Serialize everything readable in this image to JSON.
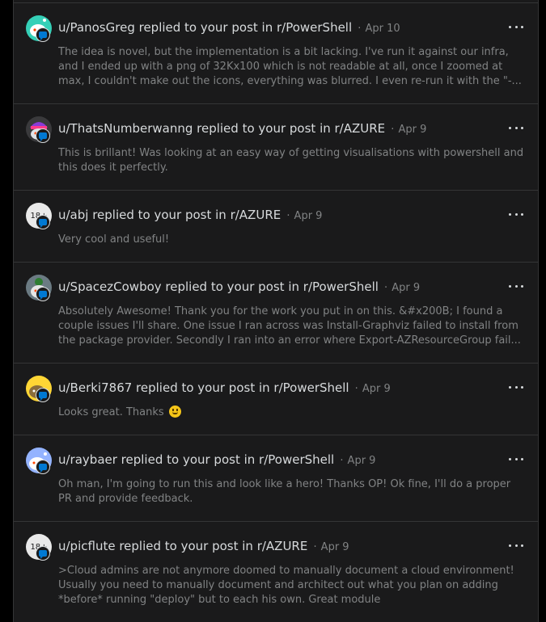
{
  "notifications": [
    {
      "title": "u/PanosGreg replied to your post in r/PowerShell",
      "separator": "·",
      "date": "Apr 10",
      "body": "The idea is novel, but the implementation is a bit lacking. I've run it against our infra, and I ended up with a png of 32Kx100 which is not readable at all, once I zoomed at max, I couldn't make out the icons, everything was blurred. I even re-run it with the \"-...",
      "avatar": "snoo-avatar-teal"
    },
    {
      "title": "u/ThatsNumberwanng replied to your post in r/AZURE",
      "separator": "·",
      "date": "Apr 9",
      "body": "This is brillant! Was looking at an easy way of getting visualisations with powershell and this does it perfectly.",
      "avatar": "snoo-avatar-costume"
    },
    {
      "title": "u/abj replied to your post in r/AZURE",
      "separator": "·",
      "date": "Apr 9",
      "body": "Very cool and useful!",
      "avatar": "nsfw-avatar",
      "avatar_text": "18+"
    },
    {
      "title": "u/SpacezCowboy replied to your post in r/PowerShell",
      "separator": "·",
      "date": "Apr 9",
      "body": "Absolutely Awesome! Thank you for the work you put in on this. &#x200B; I found a couple issues I'll share. One issue I ran across was Install-Graphviz failed to install from the package provider. Secondly I ran into an error where Export-AZResourceGroup fail...",
      "avatar": "snoo-avatar-gray"
    },
    {
      "title": "u/Berki7867 replied to your post in r/PowerShell",
      "separator": "·",
      "date": "Apr 9",
      "body": "Looks great. Thanks",
      "emoji": "slightly-smiling-face-icon",
      "avatar": "snoo-avatar-yellow"
    },
    {
      "title": "u/raybaer replied to your post in r/PowerShell",
      "separator": "·",
      "date": "Apr 9",
      "body": "Oh man, I'm going to run this and look like a hero! Thanks OP! Ok fine, I'll do a proper PR and provide feedback.",
      "avatar": "snoo-avatar-lavender"
    },
    {
      "title": "u/picflute replied to your post in r/AZURE",
      "separator": "·",
      "date": "Apr 9",
      "body": ">Cloud admins are not anymore doomed to manually document a cloud environment! Usually you need to manually document and architect out what you plan on adding *before* running \"deploy\" but to each his own. Great module",
      "avatar": "nsfw-avatar",
      "avatar_text": "18+"
    }
  ],
  "colors": {
    "panel": "#1a1a1b",
    "border": "#343536",
    "title_text": "#d7dadc",
    "meta_text": "#818384",
    "badge_blue": "#0079d3"
  }
}
